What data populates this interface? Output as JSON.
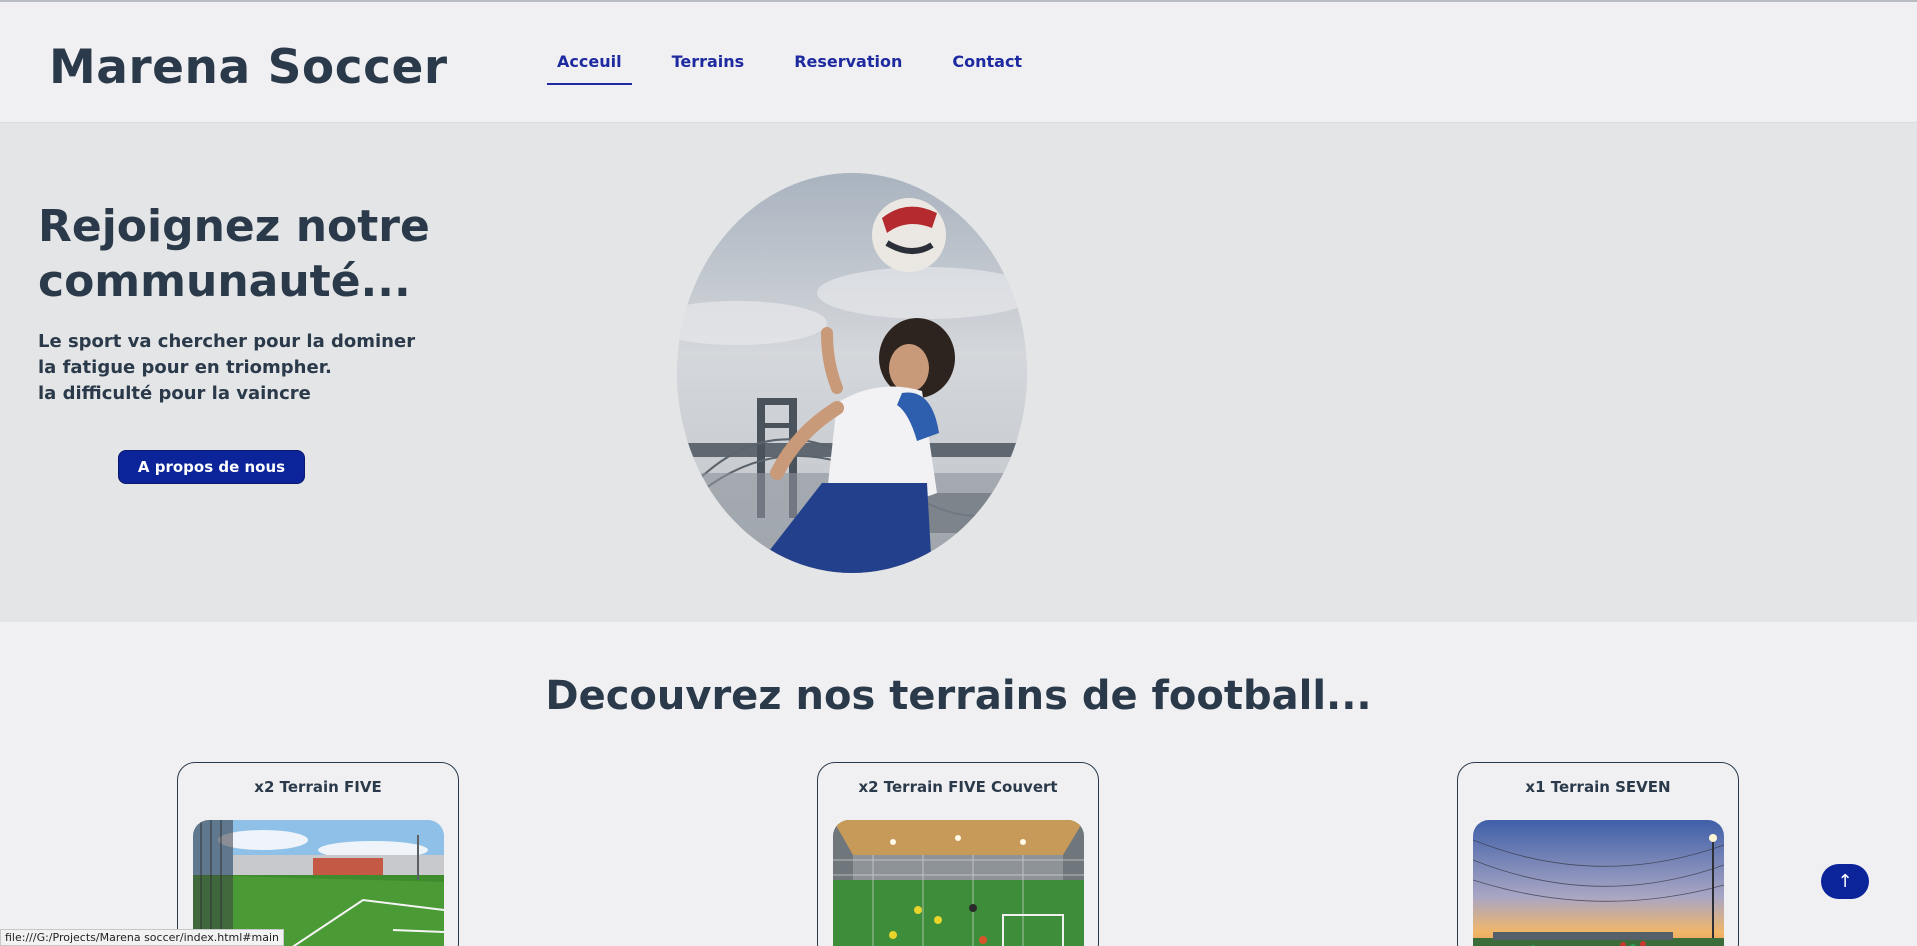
{
  "site": {
    "logo": "Marena Soccer"
  },
  "nav": {
    "items": [
      {
        "label": "Acceuil"
      },
      {
        "label": "Terrains"
      },
      {
        "label": "Reservation"
      },
      {
        "label": "Contact"
      }
    ]
  },
  "hero": {
    "title": "Rejoignez notre communauté...",
    "lines": [
      "Le sport va chercher pour la dominer",
      "la fatigue pour en triompher.",
      "la difficulté pour la vaincre"
    ],
    "button_label": "A propos de nous"
  },
  "terrains": {
    "heading": "Decouvrez nos terrains de football...",
    "cards": [
      {
        "title": "x2 Terrain FIVE"
      },
      {
        "title": "x2 Terrain FIVE Couvert"
      },
      {
        "title": "x1 Terrain SEVEN"
      }
    ]
  },
  "status_bar": {
    "url": "file:///G:/Projects/Marena soccer/index.html#main"
  },
  "scroll_top": {
    "label": "↑"
  },
  "colors": {
    "primary": "#0c2499",
    "nav_text": "#1e2aa0",
    "heading": "#2b3a4a",
    "hero_bg": "#e4e5e6",
    "page_bg": "#f0f0f2"
  },
  "icons": {
    "scroll_top": "arrow-up-icon"
  }
}
